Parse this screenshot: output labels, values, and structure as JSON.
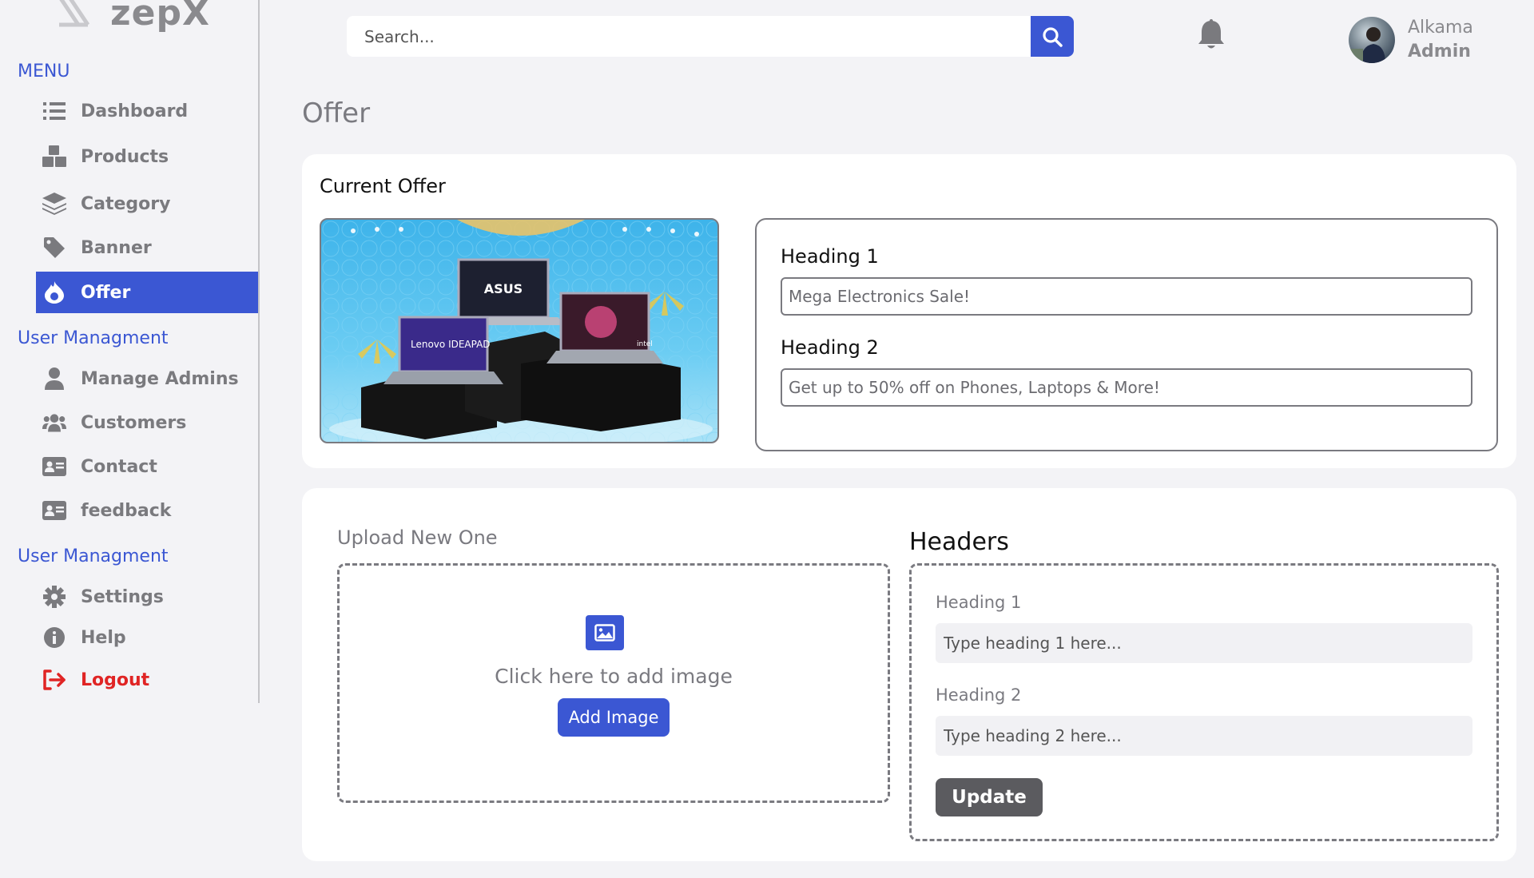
{
  "app": {
    "logo_text": "zepX"
  },
  "sidebar": {
    "sections": [
      {
        "title": "MENU"
      },
      {
        "title": "User Managment"
      },
      {
        "title": "User Managment"
      }
    ],
    "items": [
      {
        "label": "Dashboard",
        "icon": "list-icon"
      },
      {
        "label": "Products",
        "icon": "boxes-icon"
      },
      {
        "label": "Category",
        "icon": "layers-icon"
      },
      {
        "label": "Banner",
        "icon": "tag-icon"
      },
      {
        "label": "Offer",
        "icon": "fire-icon",
        "active": true
      },
      {
        "label": "Manage Admins",
        "icon": "user-icon"
      },
      {
        "label": "Customers",
        "icon": "users-icon"
      },
      {
        "label": "Contact",
        "icon": "id-card-icon"
      },
      {
        "label": "feedback",
        "icon": "id-card-icon"
      },
      {
        "label": "Settings",
        "icon": "gear-icon"
      },
      {
        "label": "Help",
        "icon": "info-icon"
      },
      {
        "label": "Logout",
        "icon": "logout-icon"
      }
    ]
  },
  "header": {
    "search": {
      "placeholder": "Search...",
      "value": ""
    },
    "user": {
      "name": "Alkama",
      "role": "Admin"
    }
  },
  "page": {
    "title": "Offer"
  },
  "current_offer": {
    "title": "Current Offer",
    "heading1_label": "Heading 1",
    "heading1_value": "Mega Electronics Sale!",
    "heading2_label": "Heading 2",
    "heading2_value": "Get up to 50% off on Phones, Laptops & More!",
    "banner_brands": [
      "ASUS",
      "Lenovo IDEAPAD",
      "intel"
    ]
  },
  "upload": {
    "label": "Upload New One",
    "click_text": "Click here to add image",
    "button_label": "Add Image"
  },
  "headers_form": {
    "title": "Headers",
    "heading1_label": "Heading 1",
    "heading1_placeholder": "Type heading 1 here...",
    "heading2_label": "Heading 2",
    "heading2_placeholder": "Type heading 2 here...",
    "update_label": "Update"
  },
  "colors": {
    "accent": "#3b57d3",
    "logout": "#e02424",
    "update_button": "#5b5b5f"
  }
}
